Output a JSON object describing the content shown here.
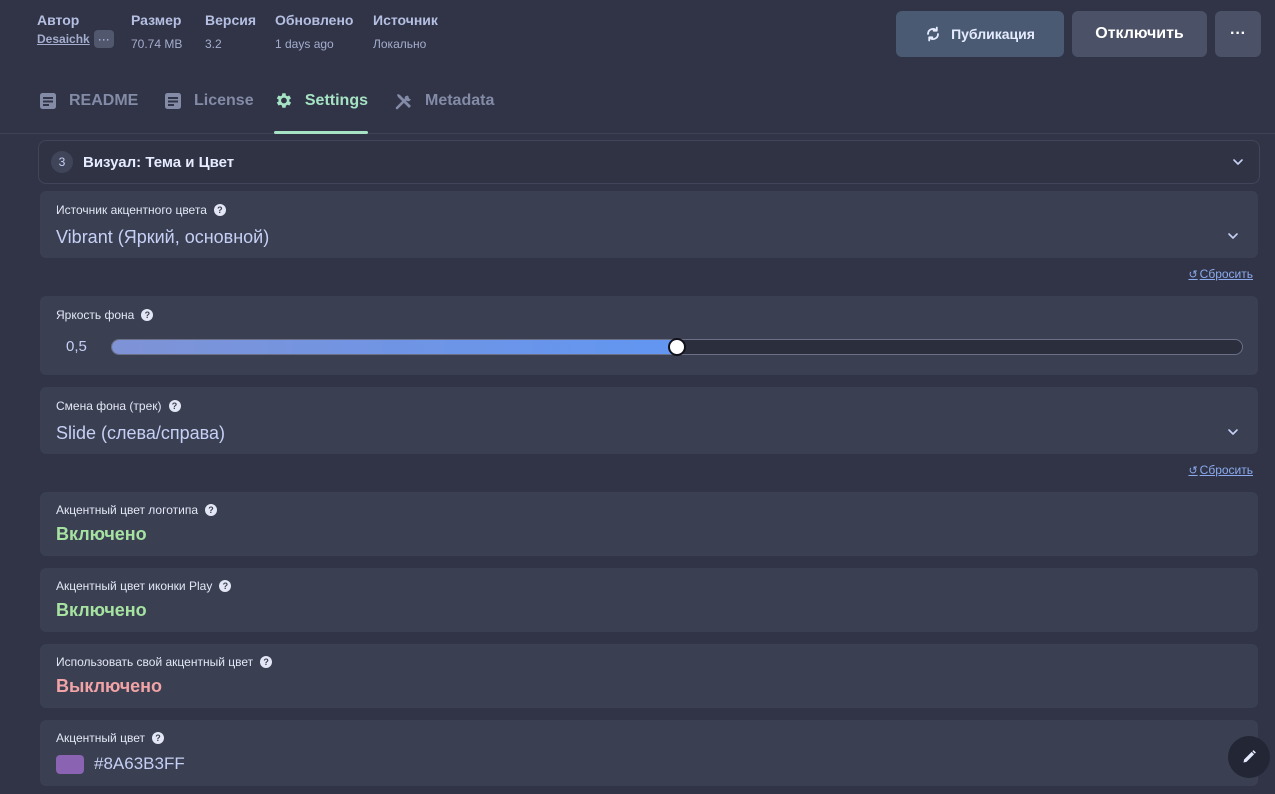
{
  "header": {
    "author_label": "Автор",
    "author_value": "Desaichk",
    "author_more": "···",
    "size_label": "Размер",
    "size_value": "70.74 MB",
    "version_label": "Версия",
    "version_value": "3.2",
    "updated_label": "Обновлено",
    "updated_value": "1 days ago",
    "source_label": "Источник",
    "source_value": "Локально",
    "publish_label": "Публикация",
    "disable_label": "Отключить",
    "more_label": "···"
  },
  "tabs": [
    {
      "label": "README",
      "icon": "readme-icon"
    },
    {
      "label": "License",
      "icon": "license-icon"
    },
    {
      "label": "Settings",
      "icon": "gear-icon"
    },
    {
      "label": "Metadata",
      "icon": "tools-icon"
    }
  ],
  "section": {
    "number": "3",
    "title": "Визуал: Тема и Цвет"
  },
  "fields": {
    "accent_source": {
      "label": "Источник акцентного цвета",
      "value": "Vibrant (Яркий, основной)"
    },
    "bg_brightness": {
      "label": "Яркость фона",
      "value_text": "0,5",
      "value": 0.5
    },
    "bg_change": {
      "label": "Смена фона (трек)",
      "value": "Slide (слева/справа)"
    },
    "logo_accent": {
      "label": "Акцентный цвет логотипа",
      "value": "Включено"
    },
    "play_accent": {
      "label": "Акцентный цвет иконки Play",
      "value": "Включено"
    },
    "custom_accent": {
      "label": "Использовать свой акцентный цвет",
      "value": "Выключено"
    },
    "accent_color": {
      "label": "Акцентный цвет",
      "value": "#8A63B3FF",
      "swatch": "#8a63b3"
    }
  },
  "reset_label": "Сбросить",
  "help_glyph": "?",
  "colors": {
    "accent_active": "#a6e3c4",
    "on": "#a6e3a1",
    "off": "#f2a3a6",
    "background": "#303446"
  }
}
